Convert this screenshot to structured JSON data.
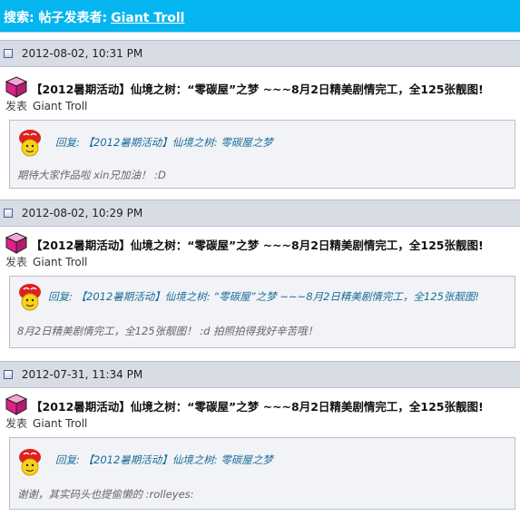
{
  "header": {
    "label": "搜索: 帖子发表者:",
    "user": "Giant Troll"
  },
  "posts": [
    {
      "date": "2012-08-02, 10:31 PM",
      "title": "【2012暑期活动】仙境之树：“零碳屋”之梦 ~~~8月2日精美剧情完工，全125张靓图!",
      "poster_label": "发表",
      "poster_name": "Giant Troll",
      "quote_header": "回复: 【2012暑期活动】仙境之树: 零碳屋之梦",
      "quote_text": "期待大家作品啦 xin兄加油！ :D"
    },
    {
      "date": "2012-08-02, 10:29 PM",
      "title": "【2012暑期活动】仙境之树：“零碳屋”之梦 ~~~8月2日精美剧情完工，全125张靓图!",
      "poster_label": "发表",
      "poster_name": "Giant Troll",
      "quote_header": "回复: 【2012暑期活动】仙境之树: “零碳屋”之梦 ~~~8月2日精美剧情完工，全125张靓图!",
      "quote_text": "8月2日精美剧情完工，全125张靓图！ :d 拍照拍得我好辛苦哦！"
    },
    {
      "date": "2012-07-31, 11:34 PM",
      "title": "【2012暑期活动】仙境之树：“零碳屋”之梦 ~~~8月2日精美剧情完工，全125张靓图!",
      "poster_label": "发表",
      "poster_name": "Giant Troll",
      "quote_header": "回复: 【2012暑期活动】仙境之树: 零碳屋之梦",
      "quote_text": "谢谢，其实码头也提偷懒的 :rolleyes:"
    }
  ],
  "icons": {
    "page": "page-icon",
    "cube": "pink-cube-icon",
    "avatar": "troll-avatar-icon"
  },
  "colors": {
    "header_bg": "#05b5f0",
    "date_bar": "#d7dce5",
    "quote_link": "#1b6c9b"
  }
}
